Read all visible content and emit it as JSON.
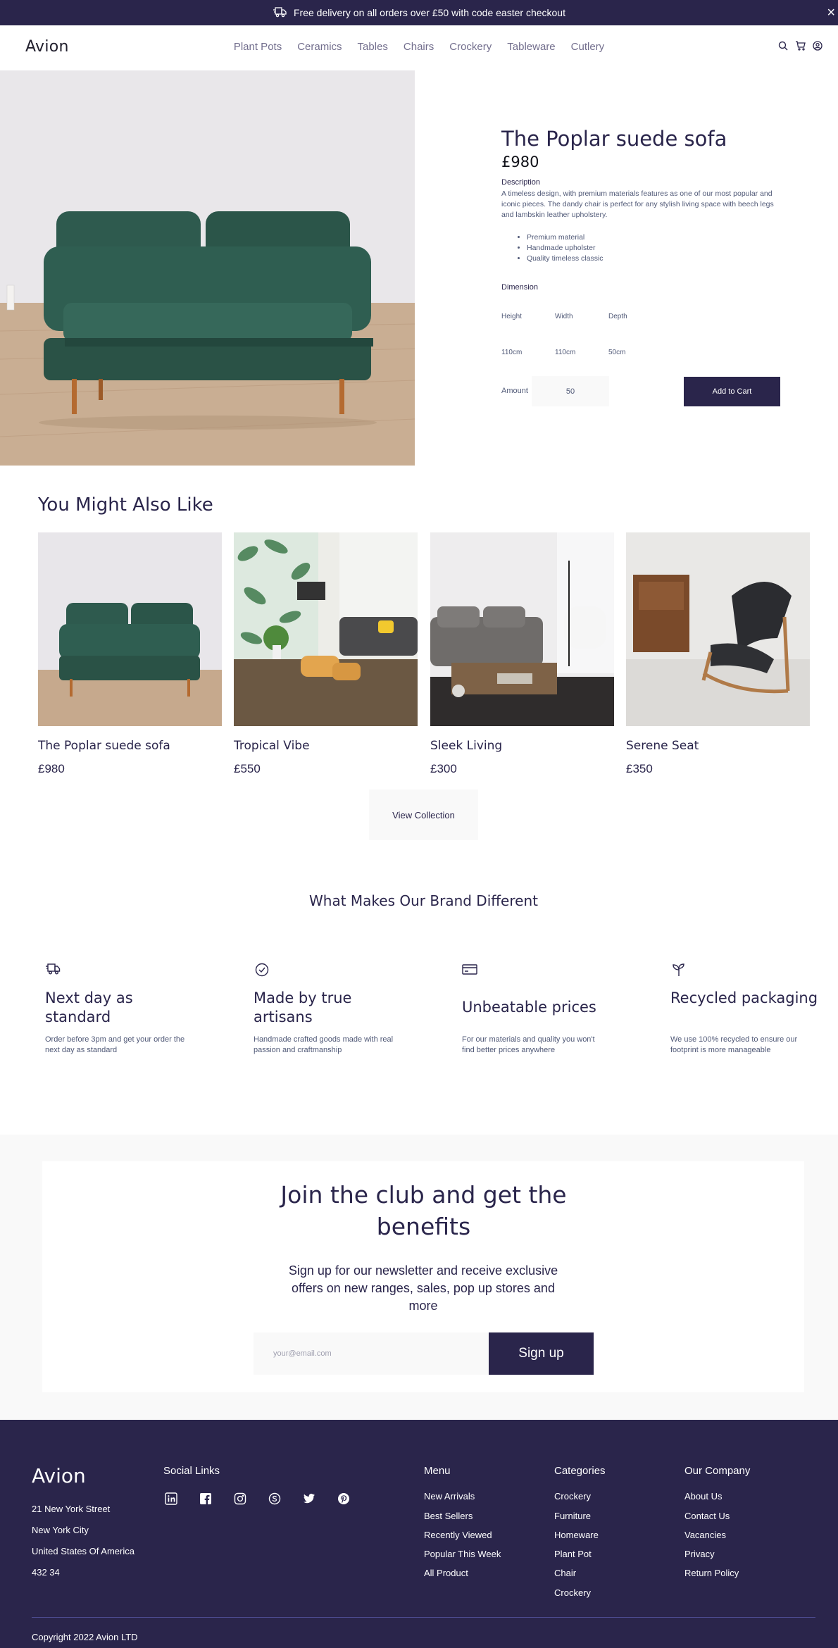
{
  "banner": {
    "text": "Free delivery on all orders over £50 with code easter checkout",
    "close": "×"
  },
  "header": {
    "brand": "Avion",
    "nav": [
      "Plant Pots",
      "Ceramics",
      "Tables",
      "Chairs",
      "Crockery",
      "Tableware",
      "Cutlery"
    ],
    "icons": [
      "search-icon",
      "cart-icon",
      "user-icon"
    ]
  },
  "product": {
    "title": "The Poplar suede sofa",
    "price": "£980",
    "description_label": "Description",
    "description": "A timeless design, with premium materials features as one of our most popular and iconic pieces. The dandy chair is perfect for any stylish living space with beech legs and lambskin leather upholstery.",
    "features": [
      "Premium material",
      "Handmade upholster",
      "Quality timeless classic"
    ],
    "dimension_label": "Dimension",
    "dimensions": [
      {
        "label": "Height",
        "value": "110cm"
      },
      {
        "label": "Width",
        "value": "110cm"
      },
      {
        "label": "Depth",
        "value": "50cm"
      }
    ],
    "amount_label": "Amount",
    "amount_value": "50",
    "add_to_cart": "Add to Cart"
  },
  "related": {
    "title": "You Might Also Like",
    "items": [
      {
        "name": "The Poplar suede sofa",
        "price": "£980"
      },
      {
        "name": "Tropical Vibe",
        "price": "£550"
      },
      {
        "name": "Sleek Living",
        "price": "£300"
      },
      {
        "name": "Serene Seat",
        "price": "£350"
      }
    ],
    "view_collection": "View Collection"
  },
  "brand_features": {
    "title": "What Makes Our Brand Different",
    "items": [
      {
        "icon": "delivery-truck-icon",
        "title": "Next day as standard",
        "text": "Order before 3pm and get your order the next day as standard"
      },
      {
        "icon": "check-circle-icon",
        "title": "Made by true artisans",
        "text": "Handmade crafted goods made with real passion and craftmanship"
      },
      {
        "icon": "credit-card-icon",
        "title": "Unbeatable prices",
        "text": "For our materials and quality you won't find better prices anywhere"
      },
      {
        "icon": "sprout-icon",
        "title": "Recycled packaging",
        "text": "We use 100% recycled to ensure our footprint is more manageable"
      }
    ]
  },
  "newsletter": {
    "title_line1": "Join the club and get the",
    "title_line2": "benefits",
    "text": "Sign up for our newsletter and receive exclusive offers on new ranges, sales, pop up stores and more",
    "placeholder": "your@email.com",
    "button": "Sign up"
  },
  "footer": {
    "brand": "Avion",
    "address": [
      "21 New York Street",
      "New York City",
      "United States Of America",
      "432 34"
    ],
    "social_heading": "Social Links",
    "social_icons": [
      "linkedin-icon",
      "facebook-icon",
      "instagram-icon",
      "skype-icon",
      "twitter-icon",
      "pinterest-icon"
    ],
    "menu_heading": "Menu",
    "menu": [
      "New Arrivals",
      "Best Sellers",
      "Recently Viewed",
      "Popular This Week",
      "All Product"
    ],
    "categories_heading": "Categories",
    "categories": [
      "Crockery",
      "Furniture",
      "Homeware",
      "Plant Pot",
      "Chair",
      "Crockery"
    ],
    "company_heading": "Our Company",
    "company": [
      "About Us",
      "Contact Us",
      "Vacancies",
      "Privacy",
      "Return Policy"
    ],
    "copyright": "Copyright 2022 Avion LTD"
  },
  "colors": {
    "primary": "#2A254B",
    "muted": "#505977",
    "light_bg": "#F9F9F9",
    "nav_text": "#726E8D"
  }
}
